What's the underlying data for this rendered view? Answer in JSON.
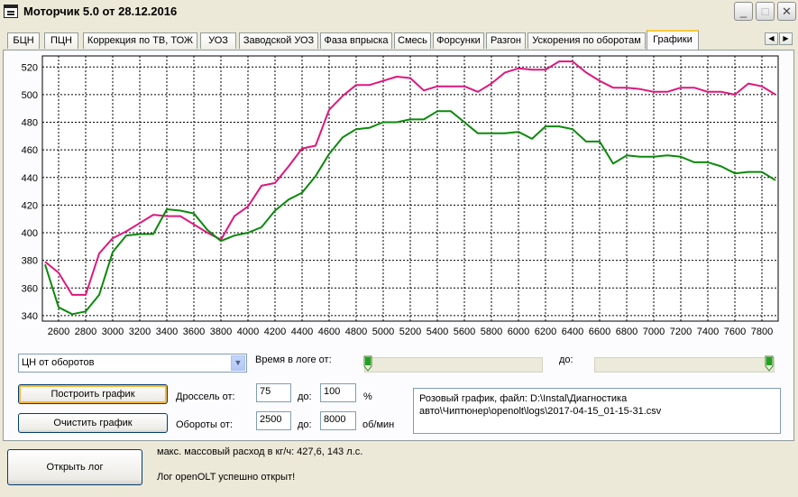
{
  "window": {
    "title": "Моторчик 5.0 от 28.12.2016",
    "controls": {
      "minimize": "_",
      "maximize": "□",
      "close": "✕"
    }
  },
  "tabs": [
    {
      "label": "БЦН"
    },
    {
      "label": "ПЦН"
    },
    {
      "label": "Коррекция по ТВ, ТОЖ"
    },
    {
      "label": "УОЗ"
    },
    {
      "label": "Заводской УОЗ"
    },
    {
      "label": "Фаза впрыска"
    },
    {
      "label": "Смесь"
    },
    {
      "label": "Форсунки"
    },
    {
      "label": "Разгон"
    },
    {
      "label": "Ускорения по оборотам"
    },
    {
      "label": "Графики",
      "active": true
    }
  ],
  "tab_scroll": {
    "left": "◀",
    "right": "▶"
  },
  "controls": {
    "graph_type": "ЦН от оборотов",
    "time_label": "Время в логе от:",
    "time_to_label": "до:",
    "build_button": "Построить график",
    "clear_button": "Очистить график",
    "throttle_label": "Дроссель от:",
    "throttle_from": "75",
    "throttle_to_label": "до:",
    "throttle_to": "100",
    "throttle_unit": "%",
    "rpm_label": "Обороты от:",
    "rpm_from": "2500",
    "rpm_to_label": "до:",
    "rpm_to": "8000",
    "rpm_unit": "об/мин",
    "info_line1": "Розовый график, файл: D:\\Instal\\Диагностика",
    "info_line2": "авто\\Чиптюнер\\openolt\\logs\\2017-04-15_01-15-31.csv"
  },
  "bottom": {
    "open_button": "Открыть лог",
    "status1": "макс. массовый расход в кг/ч: 427,6, 143 л.с.",
    "status2": "Лог openOLT успешно открыт!"
  },
  "colors": {
    "pink": "#e0167e",
    "green": "#0b8a0b"
  },
  "chart_data": {
    "type": "line",
    "grid": true,
    "xlim": [
      2480,
      7920
    ],
    "ylim": [
      336,
      528
    ],
    "x_ticks": [
      2600,
      2800,
      3000,
      3200,
      3400,
      3600,
      3800,
      4000,
      4200,
      4400,
      4600,
      4800,
      5000,
      5200,
      5400,
      5600,
      5800,
      6000,
      6200,
      6400,
      6600,
      6800,
      7000,
      7200,
      7400,
      7600,
      7800
    ],
    "y_ticks": [
      340,
      360,
      380,
      400,
      420,
      440,
      460,
      480,
      500,
      520
    ],
    "series": [
      {
        "color": "#e0167e",
        "x": [
          2500,
          2600,
          2700,
          2800,
          2900,
          3000,
          3100,
          3200,
          3300,
          3400,
          3500,
          3600,
          3700,
          3800,
          3900,
          4000,
          4100,
          4200,
          4300,
          4400,
          4500,
          4600,
          4700,
          4800,
          4900,
          5000,
          5100,
          5200,
          5300,
          5400,
          5500,
          5600,
          5700,
          5800,
          5900,
          6000,
          6100,
          6200,
          6300,
          6400,
          6500,
          6600,
          6700,
          6800,
          6900,
          7000,
          7100,
          7200,
          7300,
          7400,
          7500,
          7600,
          7700,
          7800,
          7900
        ],
        "y": [
          379,
          371,
          355,
          355,
          385,
          396,
          401,
          407,
          413,
          412,
          412,
          406,
          400,
          395,
          412,
          419,
          434,
          436,
          448,
          461,
          463,
          489,
          499,
          507,
          507,
          510,
          513,
          512,
          503,
          506,
          506,
          506,
          502,
          508,
          516,
          519,
          518,
          518,
          524,
          524,
          516,
          510,
          505,
          505,
          504,
          502,
          502,
          505,
          505,
          502,
          502,
          500,
          508,
          506,
          500
        ]
      },
      {
        "color": "#0b8a0b",
        "x": [
          2500,
          2600,
          2700,
          2800,
          2900,
          3000,
          3100,
          3200,
          3300,
          3400,
          3500,
          3600,
          3700,
          3800,
          3900,
          4000,
          4100,
          4200,
          4300,
          4400,
          4500,
          4600,
          4700,
          4800,
          4900,
          5000,
          5100,
          5200,
          5300,
          5400,
          5500,
          5600,
          5700,
          5800,
          5900,
          6000,
          6100,
          6200,
          6300,
          6400,
          6500,
          6600,
          6700,
          6800,
          6900,
          7000,
          7100,
          7200,
          7300,
          7400,
          7500,
          7600,
          7700,
          7800,
          7900
        ],
        "y": [
          377,
          346,
          341,
          343,
          355,
          386,
          398,
          399,
          399,
          417,
          416,
          414,
          402,
          394,
          398,
          400,
          404,
          416,
          424,
          429,
          441,
          457,
          469,
          475,
          476,
          480,
          480,
          482,
          482,
          488,
          488,
          480,
          472,
          472,
          472,
          473,
          468,
          477,
          477,
          475,
          466,
          466,
          450,
          456,
          455,
          455,
          456,
          455,
          451,
          451,
          448,
          443,
          444,
          444,
          438
        ]
      }
    ]
  }
}
